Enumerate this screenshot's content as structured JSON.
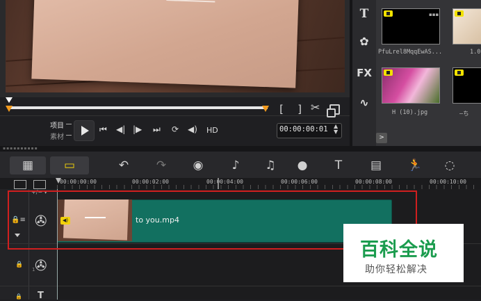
{
  "player": {
    "mode_project": "项目",
    "mode_clip": "素材",
    "hd": "HD",
    "timecode": "00:00:00:01",
    "bracket_in": "[",
    "bracket_out": "]"
  },
  "library": {
    "tools": [
      {
        "icon": "title-icon",
        "glyph": "T"
      },
      {
        "icon": "media-icon",
        "glyph": "✿"
      },
      {
        "icon": "fx-icon",
        "glyph": "FX"
      },
      {
        "icon": "path-icon",
        "glyph": "∿"
      }
    ],
    "thumbnails": [
      {
        "label": "PfuLrel8MqqEwAS..."
      },
      {
        "label": "1.0"
      },
      {
        "label": "H (10).jpg"
      },
      {
        "label": "—ち"
      }
    ],
    "nav_glyph": ">"
  },
  "toolbar": {
    "glyphs": {
      "film": "▦",
      "timeline": "▭",
      "undo": "↶",
      "redo": "↷",
      "record": "◉",
      "audio": "♪",
      "mix": "♫",
      "motion": "●",
      "title": "T",
      "grid": "▤",
      "run": "🏃",
      "zoom": "◌"
    }
  },
  "ruler": {
    "labels": [
      "00:00:00:00",
      "00:00:02:00",
      "00:00:04:00",
      "00:00:06:00",
      "00:00:08:00",
      "00:00:10:00"
    ],
    "header_controls": "+/− ▾"
  },
  "tracks": {
    "clip_name": "to you.mp4",
    "overlay_number": "1"
  },
  "watermark": {
    "main": "百科全说",
    "sub": "助你轻松解决"
  },
  "colors": {
    "accent": "#f2d20a",
    "clip": "#127060",
    "selection": "#d11f1f",
    "marker": "#f29a1e",
    "watermark_green": "#1b9c4e"
  }
}
